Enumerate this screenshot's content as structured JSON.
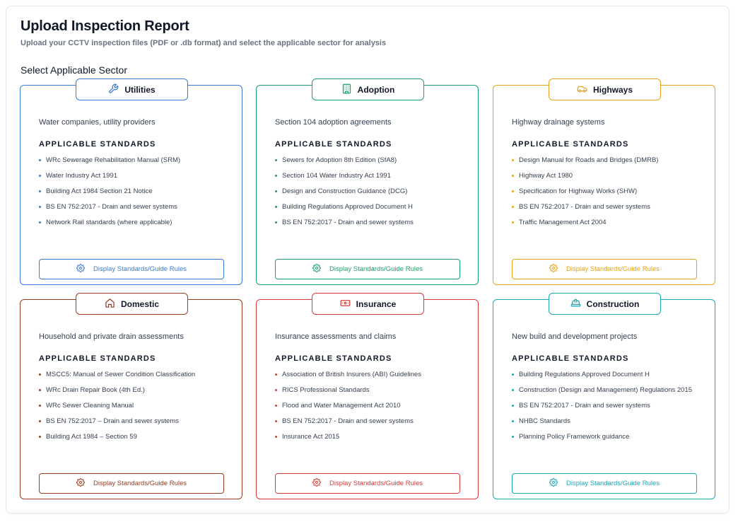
{
  "header": {
    "title": "Upload Inspection Report",
    "subtitle": "Upload your CCTV inspection files (PDF or .db format) and select the applicable sector for analysis",
    "section_label": "Select Applicable Sector"
  },
  "standards_heading": "APPLICABLE STANDARDS",
  "button_label": "Display Standards/Guide Rules",
  "sectors": [
    {
      "name": "Utilities",
      "icon": "wrench-icon",
      "color": "#3b7bd4",
      "description": "Water companies, utility providers",
      "standards": [
        "WRc Sewerage Rehabilitation Manual (SRM)",
        "Water Industry Act 1991",
        "Building Act 1984 Section 21 Notice",
        "BS EN 752:2017 - Drain and sewer systems",
        "Network Rail standards (where applicable)"
      ]
    },
    {
      "name": "Adoption",
      "icon": "building-icon",
      "color": "#1e9e6a",
      "description": "Section 104 adoption agreements",
      "standards": [
        "Sewers for Adoption 8th Edition (SfA8)",
        "Section 104 Water Industry Act 1991",
        "Design and Construction Guidance (DCG)",
        "Building Regulations Approved Document H",
        "BS EN 752:2017 - Drain and sewer systems"
      ]
    },
    {
      "name": "Highways",
      "icon": "car-icon",
      "color": "#e8a317",
      "description": "Highway drainage systems",
      "standards": [
        "Design Manual for Roads and Bridges (DMRB)",
        "Highway Act 1980",
        "Specification for Highway Works (SHW)",
        "BS EN 752:2017 - Drain and sewer systems",
        "Traffic Management Act 2004"
      ]
    },
    {
      "name": "Domestic",
      "icon": "home-icon",
      "color": "#9a3d1f",
      "description": "Household and private drain assessments",
      "standards": [
        "MSCC5: Manual of Sewer Condition Classification",
        "WRc Drain Repair Book (4th Ed.)",
        "WRc Sewer Cleaning Manual",
        "BS EN 752:2017 – Drain and sewer systems",
        "Building Act 1984 – Section 59"
      ]
    },
    {
      "name": "Insurance",
      "icon": "banknote-icon",
      "color": "#dc3b3b",
      "description": "Insurance assessments and claims",
      "standards": [
        "Association of British Insurers (ABI) Guidelines",
        "RICS Professional Standards",
        "Flood and Water Management Act 2010",
        "BS EN 752:2017 - Drain and sewer systems",
        "Insurance Act 2015"
      ]
    },
    {
      "name": "Construction",
      "icon": "hard-hat-icon",
      "color": "#1aa7b8",
      "description": "New build and development projects",
      "standards": [
        "Building Regulations Approved Document H",
        "Construction (Design and Management) Regulations 2015",
        "BS EN 752:2017 - Drain and sewer systems",
        "NHBC Standards",
        "Planning Policy Framework guidance"
      ]
    }
  ]
}
